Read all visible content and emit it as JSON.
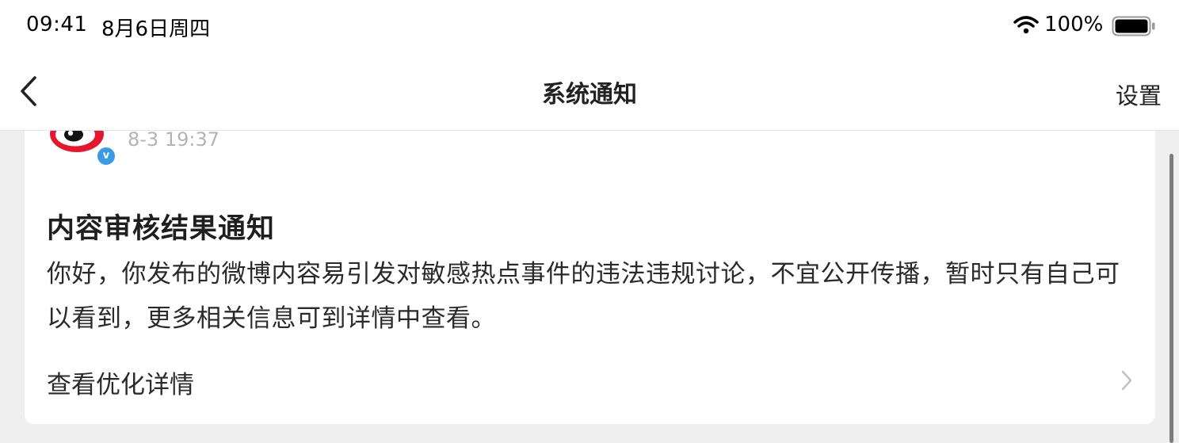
{
  "status_bar": {
    "time": "09:41",
    "date": "8月6日周四",
    "battery": "100%"
  },
  "nav": {
    "title": "系统通知",
    "settings_label": "设置"
  },
  "notice": {
    "timestamp": "8-3 19:37",
    "verified_mark": "v",
    "title": "内容审核结果通知",
    "body": "你好，你发布的微博内容易引发对敏感热点事件的违法违规讨论，不宜公开传播，暂时只有自己可以看到，更多相关信息可到详情中查看。",
    "detail_link_label": "查看优化详情"
  },
  "colors": {
    "brand_red": "#e6162d",
    "verified_blue": "#3b9ae6",
    "background": "#efefef"
  },
  "icons": {
    "back": "chevron-left-icon",
    "wifi": "wifi-icon",
    "battery": "battery-icon",
    "avatar": "weibo-logo-icon",
    "more": "more-icon",
    "link": "chevron-right-icon"
  }
}
